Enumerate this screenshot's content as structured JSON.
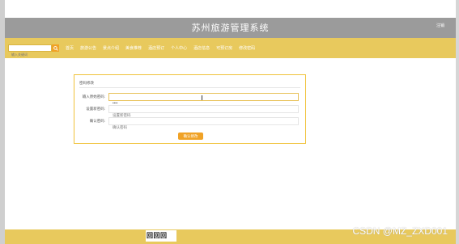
{
  "header": {
    "title": "苏州旅游管理系统",
    "user_link": "注销"
  },
  "navbar": {
    "search_placeholder": "输入关键词",
    "items": [
      "首页",
      "旅游公告",
      "景点介绍",
      "美食推荐",
      "酒店预订",
      "个人中心",
      "酒店信息",
      "可预订房",
      "修改密码"
    ]
  },
  "panel": {
    "title": "密码修改",
    "fields": [
      {
        "label": "输入原始密码:",
        "value": "••••",
        "placeholder": ""
      },
      {
        "label": "设置新密码:",
        "value": "",
        "placeholder": "设置新密码"
      },
      {
        "label": "确认密码:",
        "value": "",
        "placeholder": "确认密码"
      }
    ],
    "confirm_label": "确认修改"
  },
  "footer": {
    "qr_text": "回回回",
    "watermark": "CSDN @MZ_ZXD001"
  },
  "colors": {
    "header": "#9b9b9b",
    "navbar": "#e8c95d",
    "accent": "#f0a226",
    "panel_border": "#f0c23a"
  }
}
